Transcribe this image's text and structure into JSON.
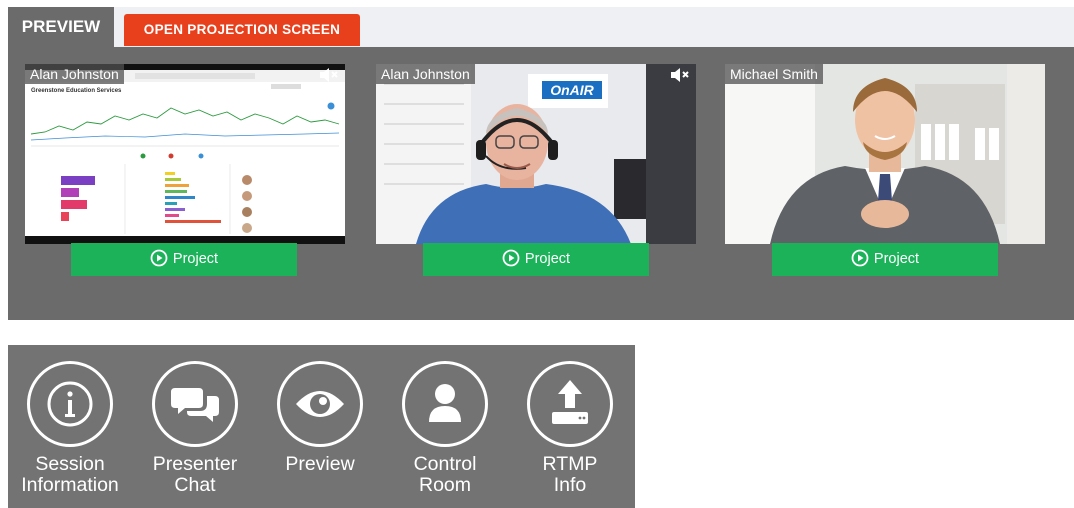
{
  "preview": {
    "tab_label": "PREVIEW",
    "open_projection_label": "OPEN PROJECTION SCREEN",
    "tiles": [
      {
        "name": "Alan Johnston",
        "project_label": "Project",
        "content": "screen-share",
        "muted": true
      },
      {
        "name": "Alan Johnston",
        "project_label": "Project",
        "content": "webcam",
        "muted": true
      },
      {
        "name": "Michael Smith",
        "project_label": "Project",
        "content": "webcam",
        "muted": false
      }
    ],
    "screen_share": {
      "chart_title": "Greenstone Education Services"
    },
    "onair_logo": "OnAIR"
  },
  "toolbar": {
    "items": [
      {
        "label_line1": "Session",
        "label_line2": "Information",
        "icon": "info-icon"
      },
      {
        "label_line1": "Presenter",
        "label_line2": "Chat",
        "icon": "chat-icon"
      },
      {
        "label_line1": "Preview",
        "label_line2": "",
        "icon": "eye-icon"
      },
      {
        "label_line1": "Control",
        "label_line2": "Room",
        "icon": "user-icon"
      },
      {
        "label_line1": "RTMP",
        "label_line2": "Info",
        "icon": "upload-icon"
      }
    ]
  },
  "colors": {
    "panel": "#6b6b6b",
    "open_projection": "#e8401c",
    "project": "#1bb25a",
    "toolbar": "#737373"
  }
}
